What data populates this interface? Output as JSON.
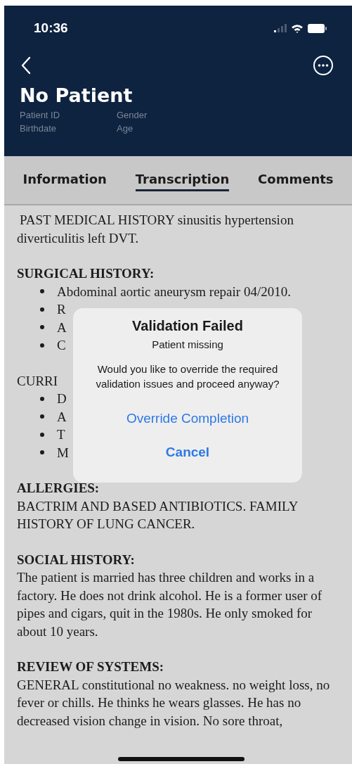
{
  "status_bar": {
    "time": "10:36"
  },
  "header": {
    "title": "No Patient",
    "fields": [
      [
        "Patient ID",
        "Gender"
      ],
      [
        "Birthdate",
        "Age"
      ]
    ]
  },
  "tabs": [
    {
      "label": "Information",
      "selected": false
    },
    {
      "label": "Transcription",
      "selected": true
    },
    {
      "label": "Comments",
      "selected": false
    }
  ],
  "document": [
    {
      "kind": "paragraph",
      "text": "PAST MEDICAL HISTORY sinusitis hypertension diverticulitis left DVT."
    },
    {
      "kind": "heading",
      "text": "SURGICAL HISTORY:"
    },
    {
      "kind": "bullets",
      "items": [
        "Abdominal aortic aneurysm repair 04/2010.",
        "R",
        "A",
        "C"
      ]
    },
    {
      "kind": "heading_plain",
      "text": "CURRI"
    },
    {
      "kind": "bullets",
      "items": [
        "D",
        "A",
        "T",
        "M"
      ]
    },
    {
      "kind": "heading",
      "text": "ALLERGIES:"
    },
    {
      "kind": "paragraph",
      "text": "BACTRIM AND BASED ANTIBIOTICS. FAMILY HISTORY OF LUNG CANCER."
    },
    {
      "kind": "heading",
      "text": "SOCIAL HISTORY:"
    },
    {
      "kind": "paragraph",
      "text": "The patient is married has three children and works in a factory. He does not drink alcohol. He is a former user of pipes and cigars, quit in the 1980s. He only smoked for about 10 years."
    },
    {
      "kind": "heading",
      "text": "REVIEW OF SYSTEMS:"
    },
    {
      "kind": "paragraph",
      "text": "GENERAL constitutional no weakness. no weight loss, no fever or chills. He thinks he wears glasses. He has no decreased vision change in vision. No sore throat,"
    }
  ],
  "dialog": {
    "title": "Validation Failed",
    "subtitle": "Patient missing",
    "message": "Would you like to override the required validation issues and proceed anyway?",
    "actions": [
      {
        "label": "Override Completion",
        "kind": "default"
      },
      {
        "label": "Cancel",
        "kind": "cancel"
      }
    ]
  }
}
